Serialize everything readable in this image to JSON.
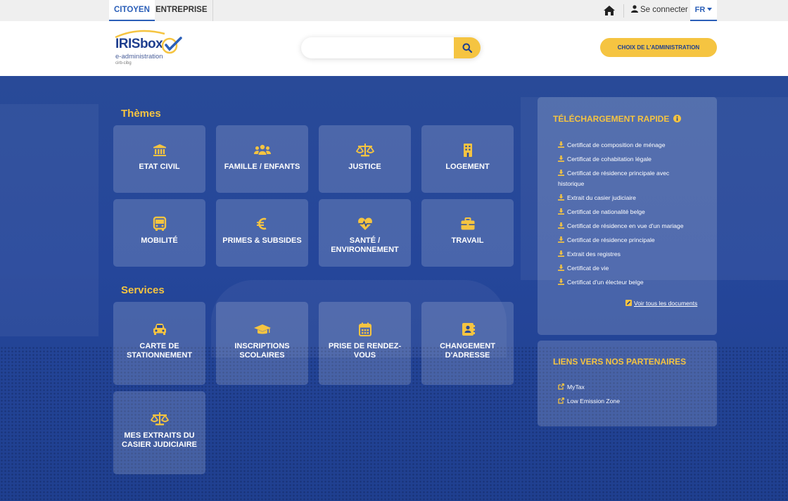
{
  "topbar": {
    "tab_citizen": "CITOYEN",
    "tab_business": "ENTREPRISE",
    "login": "Se connecter",
    "lang": "FR"
  },
  "header": {
    "logo_title": "IRISbox",
    "logo_subtitle": "e-administration",
    "logo_org": "cirb-cibg",
    "search_placeholder": "",
    "admin_button": "CHOIX DE L'ADMINISTRATION"
  },
  "themes": {
    "title": "Thèmes",
    "items": [
      {
        "label": "ETAT CIVIL",
        "icon": "bank-icon"
      },
      {
        "label": "FAMILLE / ENFANTS",
        "icon": "people-icon"
      },
      {
        "label": "JUSTICE",
        "icon": "scales-icon"
      },
      {
        "label": "LOGEMENT",
        "icon": "building-icon"
      },
      {
        "label": "MOBILITÉ",
        "icon": "bus-icon"
      },
      {
        "label": "PRIMES & SUBSIDES",
        "icon": "euro-icon"
      },
      {
        "label": "SANTÉ / ENVIRONNEMENT",
        "icon": "heart-pulse-icon"
      },
      {
        "label": "TRAVAIL",
        "icon": "briefcase-icon"
      }
    ]
  },
  "services": {
    "title": "Services",
    "items": [
      {
        "label": "CARTE DE STATIONNEMENT",
        "icon": "car-icon"
      },
      {
        "label": "INSCRIPTIONS SCOLAIRES",
        "icon": "graduation-cap-icon"
      },
      {
        "label": "PRISE DE RENDEZ-VOUS",
        "icon": "calendar-icon"
      },
      {
        "label": "CHANGEMENT D'ADRESSE",
        "icon": "address-book-icon"
      },
      {
        "label": "MES EXTRAITS DU CASIER JUDICIAIRE",
        "icon": "scales-icon"
      }
    ]
  },
  "downloads": {
    "title": "TÉLÉCHARGEMENT RAPIDE",
    "items": [
      "Certificat de composition de ménage",
      "Certificat de cohabitation légale",
      "Certificat de résidence principale avec historique",
      "Extrait du casier judiciaire",
      "Certificat de nationalité belge",
      "Certificat de résidence en vue d'un mariage",
      "Certificat de résidence principale",
      "Extrait des registres",
      "Certificat de vie",
      "Certificat d'un électeur belge"
    ],
    "see_all": "Voir tous les documents"
  },
  "partners": {
    "title": "LIENS VERS NOS PARTENAIRES",
    "items": [
      "MyTax",
      "Low Emission Zone"
    ]
  },
  "colors": {
    "accent": "#f5c441",
    "brand": "#1f3f8f",
    "link": "#2b5fb8"
  }
}
